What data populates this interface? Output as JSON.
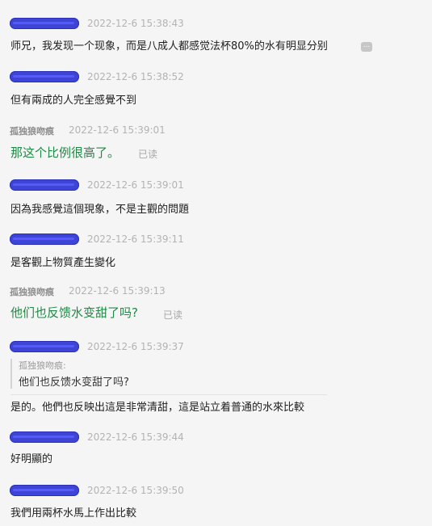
{
  "messages": [
    {
      "sender": "",
      "time": "2022-12-6 15:38:43",
      "text": "师兄，我发现一个现象，而是八成人都感觉法杯80%的水有明显分别",
      "has_more": true,
      "more_label": "..."
    },
    {
      "sender": "",
      "time": "2022-12-6 15:38:52",
      "text": "但有兩成的人完全感覺不到"
    },
    {
      "sender": "孤独狼吻痕",
      "time": "2022-12-6 15:39:01",
      "text": "那这个比例很高了。",
      "read": "已读"
    },
    {
      "sender": "",
      "time": "2022-12-6 15:39:01",
      "text": "因為我感覺這個現象，不是主觀的問題"
    },
    {
      "sender": "",
      "time": "2022-12-6 15:39:11",
      "text": "是客觀上物質產生變化"
    },
    {
      "sender": "孤独狼吻痕",
      "time": "2022-12-6 15:39:13",
      "text": "他们也反馈水变甜了吗?",
      "read": "已读"
    },
    {
      "sender": "",
      "time": "2022-12-6 15:39:37",
      "quote_sender": "孤独狼吻痕:",
      "quote_text": "他们也反馈水变甜了吗?",
      "text": "是的。他們也反映出這是非常清甜，這是站立着普通的水來比較"
    },
    {
      "sender": "",
      "time": "2022-12-6 15:39:44",
      "text": "好明顯的"
    },
    {
      "sender": "",
      "time": "2022-12-6 15:39:50",
      "text": "我們用兩杯水馬上作出比較"
    }
  ],
  "colors": {
    "background": "#f5f5f5",
    "self_text": "#1f8a46",
    "redaction": "#3d44d6"
  }
}
